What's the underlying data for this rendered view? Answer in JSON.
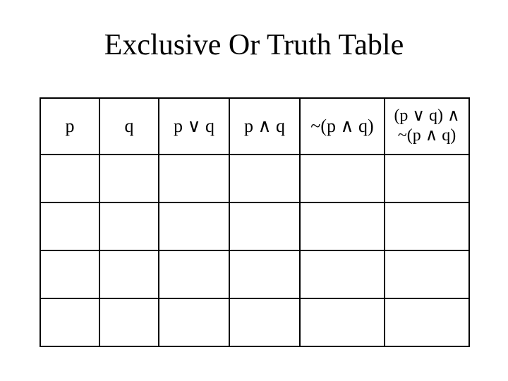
{
  "title": "Exclusive Or Truth Table",
  "headers": {
    "p": "p",
    "q": "q",
    "p_or_q": "p ∨ q",
    "p_and_q": "p ∧ q",
    "not_p_and_q": "~(p ∧ q)",
    "final_line1": "(p ∨ q) ∧",
    "final_line2": "~(p ∧ q)"
  },
  "rows": [
    {
      "p": "",
      "q": "",
      "p_or_q": "",
      "p_and_q": "",
      "not_p_and_q": "",
      "final": ""
    },
    {
      "p": "",
      "q": "",
      "p_or_q": "",
      "p_and_q": "",
      "not_p_and_q": "",
      "final": ""
    },
    {
      "p": "",
      "q": "",
      "p_or_q": "",
      "p_and_q": "",
      "not_p_and_q": "",
      "final": ""
    },
    {
      "p": "",
      "q": "",
      "p_or_q": "",
      "p_and_q": "",
      "not_p_and_q": "",
      "final": ""
    }
  ]
}
